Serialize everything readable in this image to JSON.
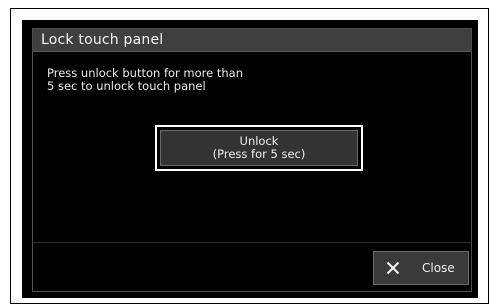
{
  "dialog": {
    "title": "Lock touch panel",
    "message_line1": "Press unlock button for more than",
    "message_line2": "5 sec to unlock touch panel"
  },
  "buttons": {
    "unlock": {
      "line1": "Unlock",
      "line2": "(Press for 5 sec)"
    },
    "close": {
      "label": "Close",
      "icon": "close-icon"
    }
  },
  "colors": {
    "background": "#000000",
    "title_bar": "#3f3f3f",
    "button_fill": "#333333",
    "text": "#f0f0f0",
    "focus_outline": "#ffffff"
  }
}
